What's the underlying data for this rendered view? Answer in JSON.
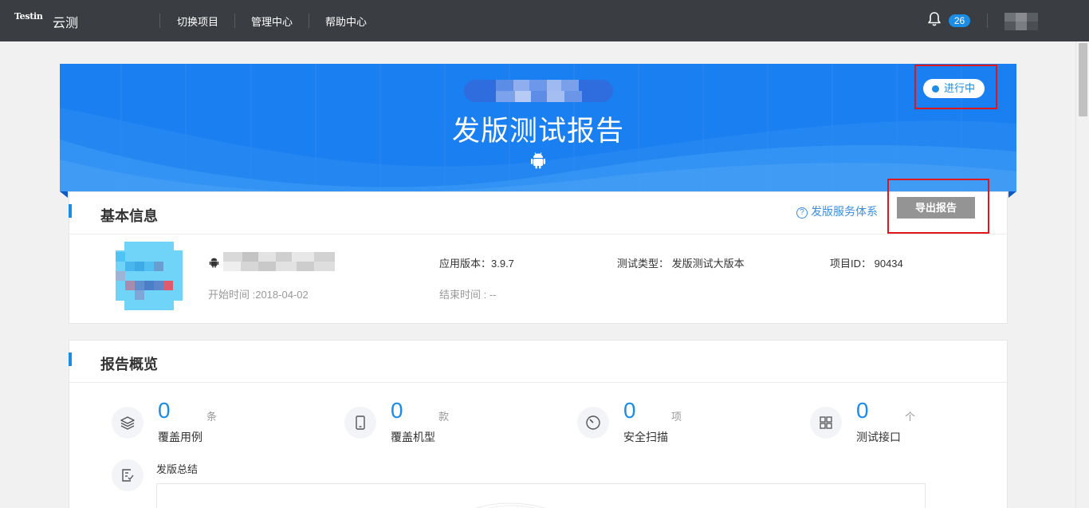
{
  "topbar": {
    "logo": "Testin",
    "brand": "云测",
    "nav": [
      "切换项目",
      "管理中心",
      "帮助中心"
    ],
    "notification_count": "26"
  },
  "banner": {
    "title": "发版测试报告",
    "status": "进行中"
  },
  "basic_info": {
    "title": "基本信息",
    "service_link": "发版服务体系",
    "export_button": "导出报告",
    "app_version": "应用版本：3.9.7",
    "test_type": "测试类型：  发版测试大版本",
    "project_id": "项目ID：  90434",
    "start_time": "开始时间 :2018-04-02",
    "end_time": "结束时间 : --"
  },
  "overview": {
    "title": "报告概览",
    "stats": [
      {
        "value": "0",
        "unit": "条",
        "label": "覆盖用例",
        "icon": "layers-icon"
      },
      {
        "value": "0",
        "unit": "款",
        "label": "覆盖机型",
        "icon": "phone-icon"
      },
      {
        "value": "0",
        "unit": "项",
        "label": "安全扫描",
        "icon": "gauge-icon"
      },
      {
        "value": "0",
        "unit": "个",
        "label": "测试接口",
        "icon": "grid-icon"
      }
    ],
    "summary_label": "发版总结",
    "summary_icon": "checklist-icon"
  },
  "colors": {
    "topbar": "#3a3d41",
    "accent": "#1c8de6",
    "banner": "#1a7ff0",
    "highlight": "#e0161c"
  }
}
